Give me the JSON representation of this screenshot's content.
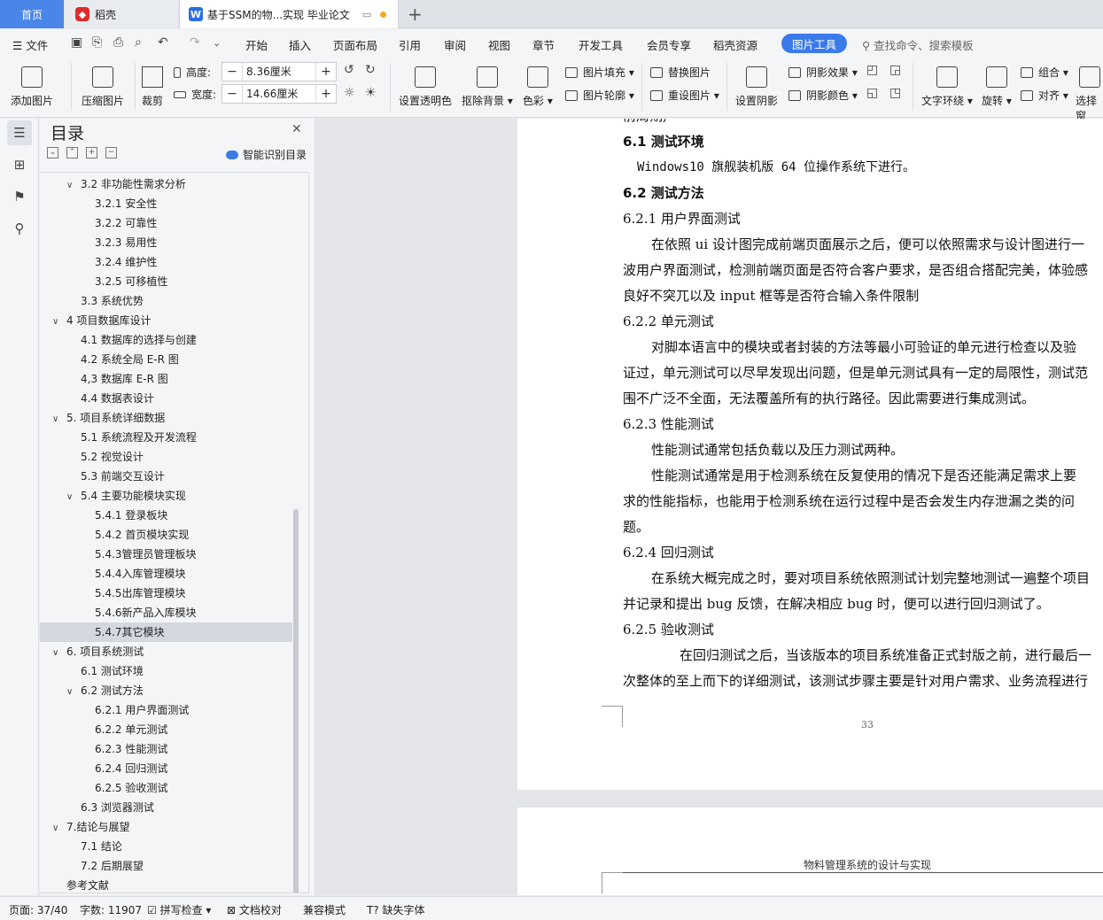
{
  "tabs": {
    "home": "首页",
    "daoke": "稻壳",
    "doc": "基于SSM的物...实现 毕业论文"
  },
  "menu": {
    "file": "文件",
    "items": [
      "开始",
      "插入",
      "页面布局",
      "引用",
      "审阅",
      "视图",
      "章节",
      "开发工具",
      "会员专享",
      "稻壳资源"
    ],
    "active": "图片工具",
    "search": "查找命令、搜索模板"
  },
  "ribbon": {
    "add_image": "添加图片",
    "compress": "压缩图片",
    "crop": "裁剪",
    "height_label": "高度:",
    "height_value": "8.36厘米",
    "width_label": "宽度:",
    "width_value": "14.66厘米",
    "transparent": "设置透明色",
    "remove_bg": "抠除背景",
    "color": "色彩",
    "fill": "图片填充",
    "outline": "图片轮廓",
    "replace": "替换图片",
    "reset": "重设图片",
    "shadow_set": "设置阴影",
    "shadow_effect": "阴影效果",
    "shadow_color": "阴影颜色",
    "wrap": "文字环绕",
    "rotate": "旋转",
    "group": "组合",
    "align": "对齐",
    "select": "选择窗"
  },
  "toc": {
    "title": "目录",
    "smart": "智能识别目录",
    "items": [
      {
        "text": "3.2   非功能性需求分析",
        "level": 1,
        "exp": true
      },
      {
        "text": "3.2.1   安全性",
        "level": 2
      },
      {
        "text": "3.2.2   可靠性",
        "level": 2
      },
      {
        "text": "3.2.3   易用性",
        "level": 2
      },
      {
        "text": "3.2.4   维护性",
        "level": 2
      },
      {
        "text": "3.2.5   可移植性",
        "level": 2
      },
      {
        "text": "3.3   系统优势",
        "level": 1
      },
      {
        "text": "4    项目数据库设计",
        "level": 0,
        "exp": true
      },
      {
        "text": "4.1   数据库的选择与创建",
        "level": 1
      },
      {
        "text": "4.2   系统全局 E-R 图",
        "level": 1
      },
      {
        "text": "4,3   数据库 E-R 图",
        "level": 1
      },
      {
        "text": "4.4   数据表设计",
        "level": 1
      },
      {
        "text": "5.   项目系统详细数据",
        "level": 0,
        "exp": true
      },
      {
        "text": "5.1   系统流程及开发流程",
        "level": 1
      },
      {
        "text": "5.2   视觉设计",
        "level": 1
      },
      {
        "text": "5.3   前端交互设计",
        "level": 1
      },
      {
        "text": "5.4   主要功能模块实现",
        "level": 1,
        "exp": true
      },
      {
        "text": "5.4.1   登录板块",
        "level": 2
      },
      {
        "text": "5.4.2   首页模块实现",
        "level": 2
      },
      {
        "text": "5.4.3管理员管理板块",
        "level": 2
      },
      {
        "text": "5.4.4入库管理模块",
        "level": 2
      },
      {
        "text": "5.4.5出库管理模块",
        "level": 2
      },
      {
        "text": "5.4.6新产品入库模块",
        "level": 2
      },
      {
        "text": "5.4.7其它模块",
        "level": 2,
        "sel": true
      },
      {
        "text": "6.   项目系统测试",
        "level": 0,
        "exp": true
      },
      {
        "text": "6.1   测试环境",
        "level": 1
      },
      {
        "text": "6.2   测试方法",
        "level": 1,
        "exp": true
      },
      {
        "text": "6.2.1  用户界面测试",
        "level": 2
      },
      {
        "text": "6.2.2  单元测试",
        "level": 2
      },
      {
        "text": "6.2.3  性能测试",
        "level": 2
      },
      {
        "text": "6.2.4  回归测试",
        "level": 2
      },
      {
        "text": "6.2.5  验收测试",
        "level": 2
      },
      {
        "text": "6.3   浏览器测试",
        "level": 1
      },
      {
        "text": "7.结论与展望",
        "level": 0,
        "exp": true
      },
      {
        "text": "7.1   结论",
        "level": 1
      },
      {
        "text": "7.2   后期展望",
        "level": 1
      },
      {
        "text": "参考文献",
        "level": 0
      }
    ]
  },
  "doc": {
    "lines": [
      {
        "t": "前周期,",
        "k": ""
      },
      {
        "t": "6.1   测试环境",
        "k": "h"
      },
      {
        "t": "Windows10 旗舰装机版 64 位操作系统下进行。",
        "k": "env"
      },
      {
        "t": "6.2   测试方法",
        "k": "h"
      },
      {
        "t": "6.2.1 用户界面测试",
        "k": ""
      },
      {
        "t": "在依照 ui 设计图完成前端页面展示之后，便可以依照需求与设计图进行一",
        "k": "ind"
      },
      {
        "t": "波用户界面测试，检测前端页面是否符合客户要求，是否组合搭配完美，体验感",
        "k": ""
      },
      {
        "t": "良好不突兀以及 input 框等是否符合输入条件限制",
        "k": ""
      },
      {
        "t": "6.2.2 单元测试",
        "k": ""
      },
      {
        "t": "对脚本语言中的模块或者封装的方法等最小可验证的单元进行检查以及验",
        "k": "ind"
      },
      {
        "t": "证过，单元测试可以尽早发现出问题，但是单元测试具有一定的局限性，测试范",
        "k": ""
      },
      {
        "t": "围不广泛不全面，无法覆盖所有的执行路径。因此需要进行集成测试。",
        "k": ""
      },
      {
        "t": "6.2.3 性能测试",
        "k": ""
      },
      {
        "t": "性能测试通常包括负载以及压力测试两种。",
        "k": "ind"
      },
      {
        "t": "性能测试通常是用于检测系统在反复使用的情况下是否还能满足需求上要",
        "k": "ind"
      },
      {
        "t": "求的性能指标，也能用于检测系统在运行过程中是否会发生内存泄漏之类的问",
        "k": ""
      },
      {
        "t": "题。",
        "k": ""
      },
      {
        "t": "6.2.4 回归测试",
        "k": ""
      },
      {
        "t": "在系统大概完成之时，要对项目系统依照测试计划完整地测试一遍整个项目",
        "k": "ind"
      },
      {
        "t": "并记录和提出 bug 反馈，在解决相应 bug 时，便可以进行回归测试了。",
        "k": ""
      },
      {
        "t": "6.2.5 验收测试",
        "k": ""
      },
      {
        "t": "在回归测试之后，当该版本的项目系统准备正式封版之前，进行最后一",
        "k": "ind2"
      },
      {
        "t": "次整体的至上而下的详细测试，该测试步骤主要是针对用户需求、业务流程进行",
        "k": ""
      }
    ],
    "page_number": "33",
    "next_header": "物料管理系统的设计与实现"
  },
  "status": {
    "page": "页面: 37/40",
    "words": "字数: 11907",
    "spell": "拼写检查",
    "proof": "文档校对",
    "compat": "兼容模式",
    "missing_font": "缺失字体"
  }
}
